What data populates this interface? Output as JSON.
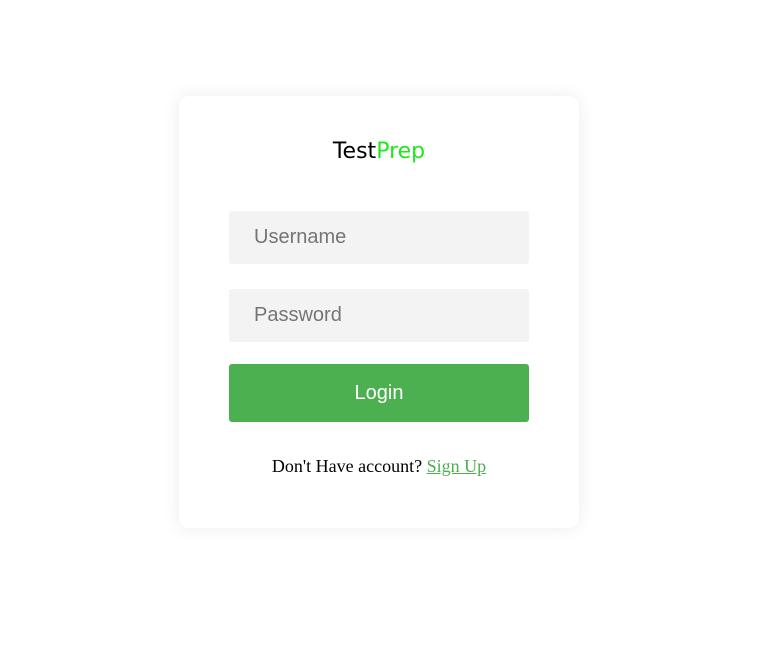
{
  "logo": {
    "part1": "Test",
    "part2": "Prep"
  },
  "form": {
    "username_placeholder": "Username",
    "password_placeholder": "Password",
    "login_label": "Login"
  },
  "footer": {
    "prompt": "Don't Have account? ",
    "signup_label": "Sign Up"
  },
  "colors": {
    "accent": "#1ee81e",
    "button": "#4caf50",
    "field_bg": "#f3f3f3"
  }
}
